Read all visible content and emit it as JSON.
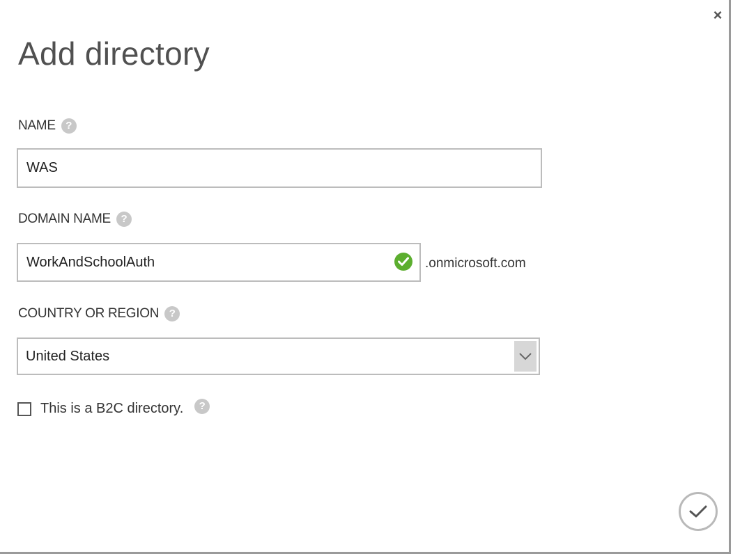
{
  "dialog": {
    "title": "Add directory",
    "close_glyph": "×"
  },
  "fields": {
    "name": {
      "label": "NAME",
      "value": "WAS"
    },
    "domain_name": {
      "label": "DOMAIN NAME",
      "value": "WorkAndSchoolAuth",
      "suffix": ".onmicrosoft.com",
      "status_icon": "check-circle-icon",
      "status_color": "#5cae2f"
    },
    "country": {
      "label": "COUNTRY OR REGION",
      "selected": "United States"
    },
    "b2c": {
      "label": "This is a B2C directory.",
      "checked": false
    }
  },
  "help_glyph": "?",
  "actions": {
    "confirm_icon": "checkmark-icon"
  }
}
